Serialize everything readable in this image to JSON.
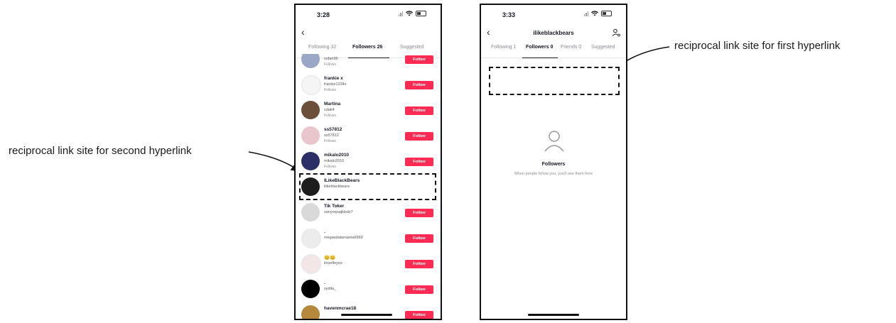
{
  "annotations": {
    "second": "reciprocal link site for second hyperlink",
    "first": "reciprocal link site for first hyperlink"
  },
  "phone1": {
    "time": "3:28",
    "tabs": [
      "Following 32",
      "Followers 26",
      "Suggested"
    ],
    "active_tab": 1,
    "follow_label": "Follow",
    "follows_you_label": "Follows",
    "users": [
      {
        "name": "",
        "handle": "sofan99",
        "follows_you": true,
        "button": true,
        "avatar": "#9aa7c6"
      },
      {
        "name": "frankie x",
        "handle": "frankie1234x",
        "follows_you": true,
        "button": true,
        "avatar": "#f5f5f5"
      },
      {
        "name": "Martina",
        "handle": "cdak4",
        "follows_you": true,
        "button": true,
        "avatar": "#6b4f3a"
      },
      {
        "name": "ss57812",
        "handle": "ss57812",
        "follows_you": true,
        "button": true,
        "avatar": "#e8c6cc"
      },
      {
        "name": "mikalo2010",
        "handle": "mikalo2010",
        "follows_you": true,
        "button": true,
        "avatar": "#2b2f66"
      },
      {
        "name": "ILikeBlackBears",
        "handle": "ilikeblackbears",
        "follows_you": false,
        "button": false,
        "avatar": "#1d1d1d"
      },
      {
        "name": "Tik Toker",
        "handle": "sanyoquajklsdz7",
        "follows_you": false,
        "button": true,
        "avatar": "#d9d9d9"
      },
      {
        "name": ".",
        "handle": "megasdatamama6969",
        "follows_you": false,
        "button": true,
        "avatar": "#ececec"
      },
      {
        "name": "😊😊",
        "handle": "ilovefleyxo",
        "follows_you": false,
        "button": true,
        "avatar": "#f3e6e6"
      },
      {
        "name": ".",
        "handle": "sydila_",
        "follows_you": false,
        "button": true,
        "avatar": "#000000"
      },
      {
        "name": "havenmcrae18",
        "handle": "",
        "follows_you": false,
        "button": true,
        "avatar": "#b5883c"
      }
    ]
  },
  "phone2": {
    "time": "3:33",
    "title": "ilikeblackbears",
    "tabs": [
      "Following 1",
      "Followers 0",
      "Friends 0",
      "Suggested"
    ],
    "active_tab": 1,
    "empty_title": "Followers",
    "empty_desc": "When people follow you, you'll see them here"
  },
  "colors": {
    "accent": "#fe2c55",
    "text": "#161823",
    "muted": "#8a8b91"
  }
}
